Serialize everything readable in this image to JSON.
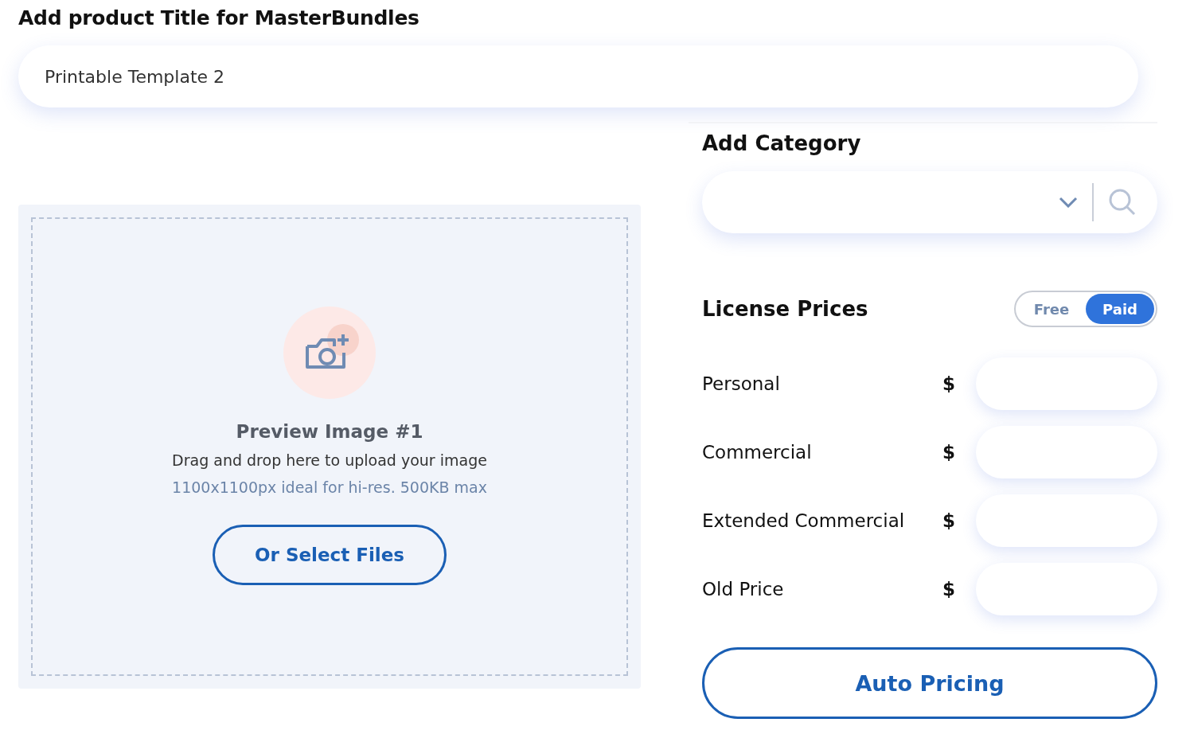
{
  "title_section": {
    "heading": "Add product Title for MasterBundles",
    "value": "Printable Template 2"
  },
  "upload": {
    "title": "Preview Image #1",
    "instruction": "Drag and drop here to upload your image",
    "hint": "1100x1100px ideal for hi-res. 500KB max",
    "button": "Or Select Files"
  },
  "category": {
    "heading": "Add Category"
  },
  "license": {
    "heading": "License Prices",
    "options": [
      {
        "label": "Free",
        "selected": false
      },
      {
        "label": "Paid",
        "selected": true
      }
    ],
    "rows": [
      {
        "label": "Personal",
        "currency": "$"
      },
      {
        "label": "Commercial",
        "currency": "$"
      },
      {
        "label": "Extended Commercial",
        "currency": "$"
      },
      {
        "label": "Old Price",
        "currency": "$"
      }
    ],
    "button": "Auto Pricing"
  }
}
